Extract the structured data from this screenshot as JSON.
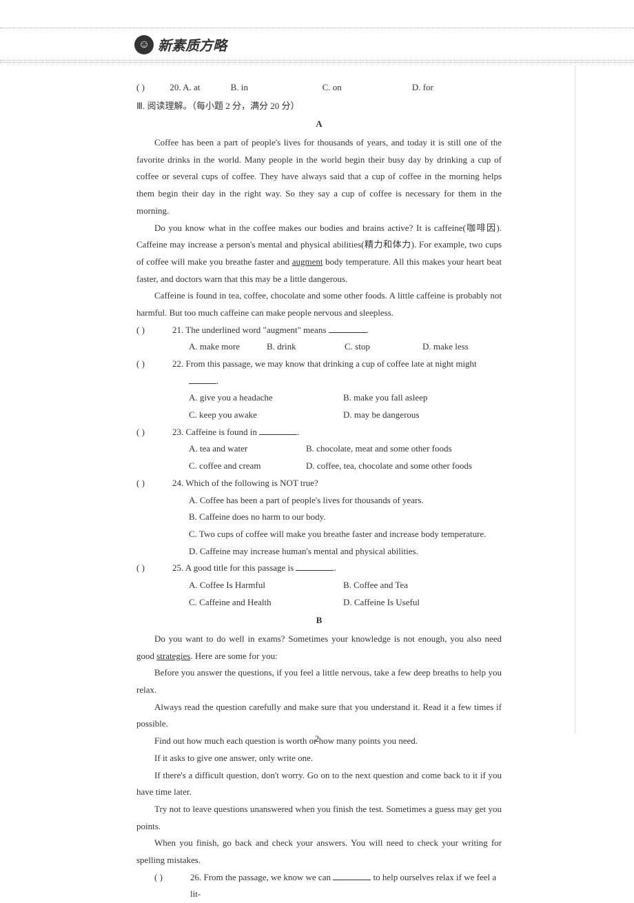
{
  "header": {
    "logo_text": "新素质方略"
  },
  "q20": {
    "paren": "(        )",
    "num": "20. A. at",
    "B": "B. in",
    "C": "C. on",
    "D": "D. for"
  },
  "section3_title": "Ⅲ. 阅读理解。（每小题 2 分，满分 20 分）",
  "passageA": {
    "label": "A",
    "p1": "Coffee has been a part of people's lives for thousands of years, and today it is still one of the favorite drinks in the world. Many people in the world begin their busy day by drinking a cup of coffee or several cups of coffee. They have always said that a cup of coffee in the morning helps them begin their day in the right way. So they say a cup of coffee is necessary for them in the morning.",
    "p2a": "Do you know what in the coffee makes our bodies and brains active? It is caffeine(咖啡因). Caffeine may increase a person's mental and physical abilities(精力和体力). For example, two cups of coffee will make you breathe faster and ",
    "p2u": "augment",
    "p2b": " body temperature. All this makes your heart beat faster, and doctors warn that this may be a little dangerous.",
    "p3": "Caffeine is found in tea, coffee, chocolate and some other foods. A little caffeine is probably not harmful. But too much caffeine can make people nervous and sleepless."
  },
  "q21": {
    "paren": "(        )",
    "text": "21. The underlined word \"augment\" means ",
    "A": "A. make more",
    "B": "B. drink",
    "C": "C. stop",
    "D": "D. make less"
  },
  "q22": {
    "paren": "(        )",
    "text": "22. From this passage, we may know that drinking a cup of coffee late at night might ",
    "A": "A. give you a headache",
    "B": "B. make you fall asleep",
    "C": "C. keep you awake",
    "D": "D. may be dangerous"
  },
  "q23": {
    "paren": "(        )",
    "text": "23. Caffeine is found in ",
    "A": "A. tea and water",
    "B": "B. chocolate, meat and some other foods",
    "C": "C. coffee and cream",
    "D": "D. coffee, tea, chocolate and some other foods"
  },
  "q24": {
    "paren": "(        )",
    "text": "24. Which of the following is NOT true?",
    "A": "A. Coffee has been a part of people's lives for thousands of years.",
    "B": "B. Caffeine does no harm to our body.",
    "C": "C. Two cups of coffee will make you breathe faster and increase body temperature.",
    "D": "D. Caffeine may increase human's mental and physical abilities."
  },
  "q25": {
    "paren": "(        )",
    "text": "25. A good title for this passage is ",
    "A": "A. Coffee Is Harmful",
    "B": "B. Coffee and Tea",
    "C": "C. Caffeine and Health",
    "D": "D. Caffeine Is Useful"
  },
  "passageB": {
    "label": "B",
    "p1a": "Do you want to do well in exams? Sometimes your knowledge is not enough, you also need good ",
    "p1u": "strategies",
    "p1b": ". Here are some for you:",
    "p2": "Before you answer the questions, if you feel a little nervous, take a few deep breaths to help you relax.",
    "p3": "Always read the question carefully and make sure that you understand it. Read it a few times if possible.",
    "p4": "Find out how much each question is worth or how many points you need.",
    "p5": "If it asks to give one answer, only write one.",
    "p6": "If there's a difficult question, don't worry. Go on to the next question and come back to it if you have time later.",
    "p7": "Try not to leave questions unanswered when you finish the test. Sometimes a guess may get you points.",
    "p8": "When you finish, go back and check your answers. You will need to check your writing for spelling mistakes."
  },
  "q26": {
    "paren": "(        )",
    "text_a": "26. From the passage, we know we can ",
    "text_b": " to help ourselves relax if we feel a lit-"
  },
  "page_number": "2"
}
